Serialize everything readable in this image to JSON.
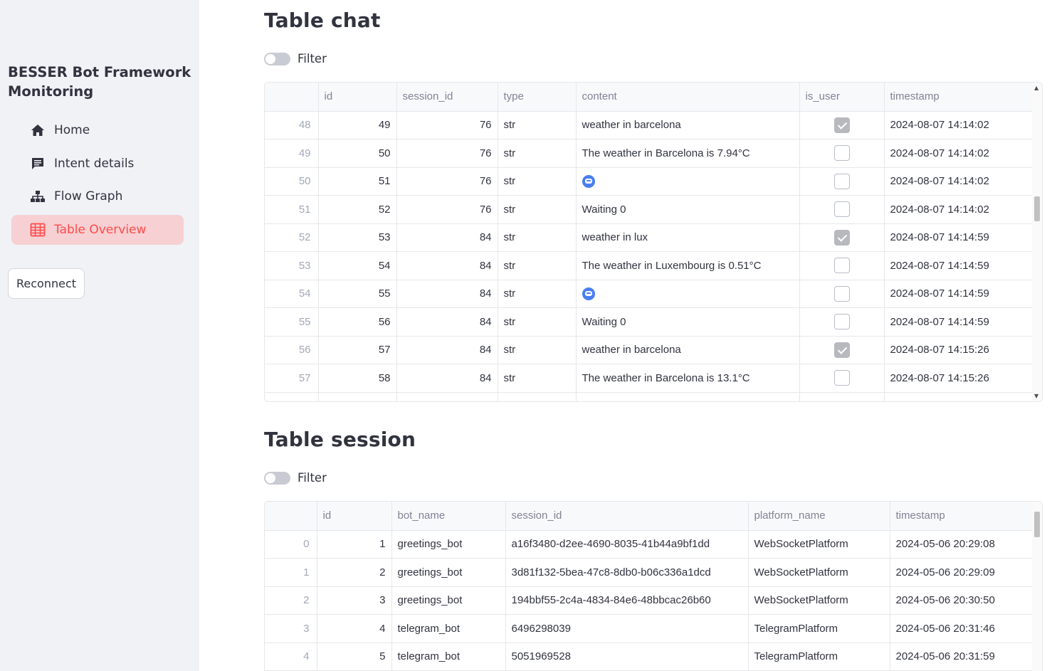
{
  "sidebar": {
    "title": "BESSER Bot Framework Monitoring",
    "items": [
      {
        "label": "Home",
        "icon": "home-icon"
      },
      {
        "label": "Intent details",
        "icon": "chat-icon"
      },
      {
        "label": "Flow Graph",
        "icon": "sitemap-icon"
      },
      {
        "label": "Table Overview",
        "icon": "table-icon",
        "active": true
      }
    ],
    "reconnect_label": "Reconnect"
  },
  "chat_section": {
    "title": "Table chat",
    "filter_label": "Filter",
    "columns": [
      "",
      "id",
      "session_id",
      "type",
      "content",
      "is_user",
      "timestamp"
    ],
    "rows": [
      {
        "idx": "48",
        "id": "49",
        "session_id": "76",
        "type": "str",
        "content": "weather in barcelona",
        "is_user": true,
        "timestamp": "2024-08-07 14:14:02"
      },
      {
        "idx": "49",
        "id": "50",
        "session_id": "76",
        "type": "str",
        "content": "The weather in Barcelona is 7.94°C",
        "is_user": false,
        "timestamp": "2024-08-07 14:14:02"
      },
      {
        "idx": "50",
        "id": "51",
        "session_id": "76",
        "type": "str",
        "content": "",
        "emoji": true,
        "is_user": false,
        "timestamp": "2024-08-07 14:14:02"
      },
      {
        "idx": "51",
        "id": "52",
        "session_id": "76",
        "type": "str",
        "content": "Waiting 0",
        "is_user": false,
        "timestamp": "2024-08-07 14:14:02"
      },
      {
        "idx": "52",
        "id": "53",
        "session_id": "84",
        "type": "str",
        "content": "weather in lux",
        "is_user": true,
        "timestamp": "2024-08-07 14:14:59"
      },
      {
        "idx": "53",
        "id": "54",
        "session_id": "84",
        "type": "str",
        "content": "The weather in Luxembourg is 0.51°C",
        "is_user": false,
        "timestamp": "2024-08-07 14:14:59"
      },
      {
        "idx": "54",
        "id": "55",
        "session_id": "84",
        "type": "str",
        "content": "",
        "emoji": true,
        "is_user": false,
        "timestamp": "2024-08-07 14:14:59"
      },
      {
        "idx": "55",
        "id": "56",
        "session_id": "84",
        "type": "str",
        "content": "Waiting 0",
        "is_user": false,
        "timestamp": "2024-08-07 14:14:59"
      },
      {
        "idx": "56",
        "id": "57",
        "session_id": "84",
        "type": "str",
        "content": "weather in barcelona",
        "is_user": true,
        "timestamp": "2024-08-07 14:15:26"
      },
      {
        "idx": "57",
        "id": "58",
        "session_id": "84",
        "type": "str",
        "content": "The weather in Barcelona is 13.1°C",
        "is_user": false,
        "timestamp": "2024-08-07 14:15:26"
      }
    ]
  },
  "session_section": {
    "title": "Table session",
    "filter_label": "Filter",
    "columns": [
      "",
      "id",
      "bot_name",
      "session_id",
      "platform_name",
      "timestamp"
    ],
    "rows": [
      {
        "idx": "0",
        "id": "1",
        "bot_name": "greetings_bot",
        "session_id": "a16f3480-d2ee-4690-8035-41b44a9bf1dd",
        "platform_name": "WebSocketPlatform",
        "timestamp": "2024-05-06 20:29:08"
      },
      {
        "idx": "1",
        "id": "2",
        "bot_name": "greetings_bot",
        "session_id": "3d81f132-5bea-47c8-8db0-b06c336a1dcd",
        "platform_name": "WebSocketPlatform",
        "timestamp": "2024-05-06 20:29:09"
      },
      {
        "idx": "2",
        "id": "3",
        "bot_name": "greetings_bot",
        "session_id": "194bbf55-2c4a-4834-84e6-48bbcac26b60",
        "platform_name": "WebSocketPlatform",
        "timestamp": "2024-05-06 20:30:50"
      },
      {
        "idx": "3",
        "id": "4",
        "bot_name": "telegram_bot",
        "session_id": "6496298039",
        "platform_name": "TelegramPlatform",
        "timestamp": "2024-05-06 20:31:46"
      },
      {
        "idx": "4",
        "id": "5",
        "bot_name": "telegram_bot",
        "session_id": "5051969528",
        "platform_name": "TelegramPlatform",
        "timestamp": "2024-05-06 20:31:59"
      }
    ]
  },
  "colors": {
    "accent": "#ff4b4b",
    "active_bg": "#f7d0d3",
    "sidebar_bg": "#f0f2f6"
  }
}
